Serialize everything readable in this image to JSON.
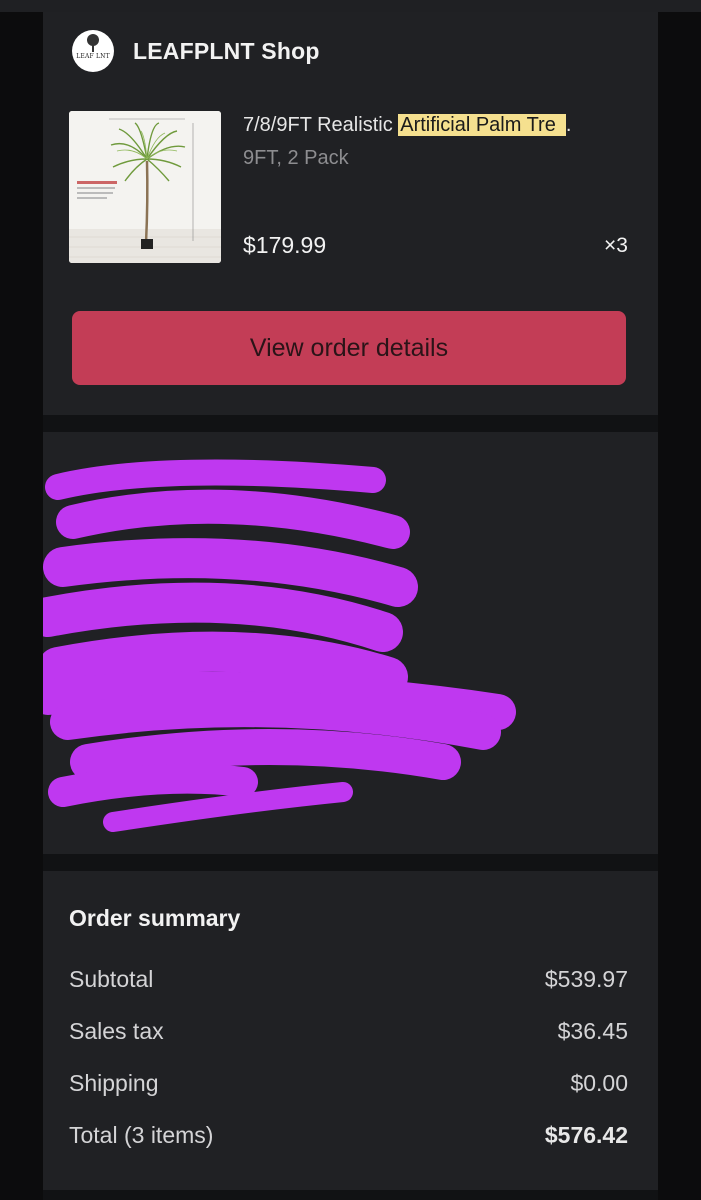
{
  "shop": {
    "name": "LEAFPLNT Shop",
    "logo_text": "LEAF LNT"
  },
  "product": {
    "title_prefix": "7/8/9FT Realistic ",
    "title_highlight": "Artificial Palm Tre",
    "title_suffix": ".",
    "variant": "9FT, 2 Pack",
    "price": "$179.99",
    "quantity": "×3",
    "thumb_labels": {
      "width": "51.2 inch/ 130 cm",
      "height": "106.3 inch/ 270 cm",
      "pot_height": "6.9 inch / 17.5 cm",
      "base": "7.9 inch/ 20 cm",
      "note": "Note: The height is the size of the leaves when they are straightened. The height may be lower than 9ft after adjusting the leaves."
    }
  },
  "actions": {
    "view_order": "View order details"
  },
  "summary": {
    "title": "Order summary",
    "rows": [
      {
        "label": "Subtotal",
        "value": "$539.97"
      },
      {
        "label": "Sales tax",
        "value": "$36.45"
      },
      {
        "label": "Shipping",
        "value": "$0.00"
      },
      {
        "label": "Total (3 items)",
        "value": "$576.42"
      }
    ]
  },
  "colors": {
    "background": "#111214",
    "card": "#202124",
    "button": "#c33d56",
    "highlight": "#f5e08f",
    "redaction": "#bf38f0"
  }
}
